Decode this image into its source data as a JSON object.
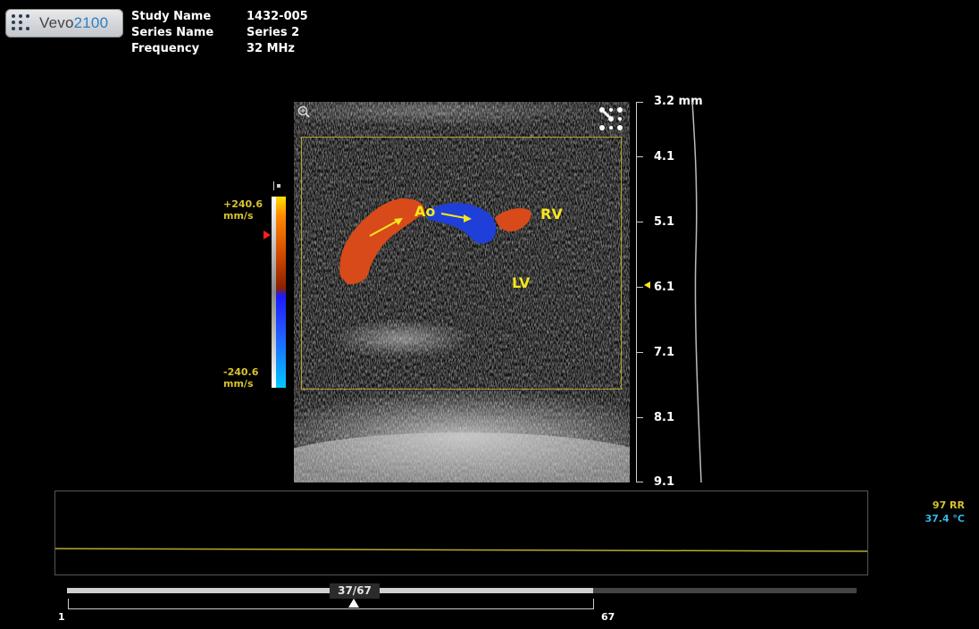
{
  "app": {
    "logo_text": "Vevo",
    "logo_num": "2100"
  },
  "study": {
    "study_name_label": "Study Name",
    "study_name_value": "1432-005",
    "series_name_label": "Series Name",
    "series_name_value": "Series 2",
    "frequency_label": "Frequency",
    "frequency_value": "32 MHz"
  },
  "color_scale": {
    "max_value": "+240.6",
    "max_unit": "mm/s",
    "min_value": "-240.6",
    "min_unit": "mm/s",
    "colors": {
      "positive": "#ff8a00",
      "negative": "#1b1bff"
    }
  },
  "image_labels": {
    "ao": "Ao",
    "rv": "RV",
    "lv": "LV"
  },
  "depth_axis": {
    "labels": [
      "3.2 mm",
      "4.1",
      "5.1",
      "6.1",
      "7.1",
      "8.1",
      "9.1"
    ]
  },
  "physio": {
    "rr": "97 RR",
    "temp": "37.4 °C"
  },
  "cine": {
    "current_frame": "37/67",
    "start": "1",
    "end": "67",
    "current": 37,
    "total": 67
  }
}
